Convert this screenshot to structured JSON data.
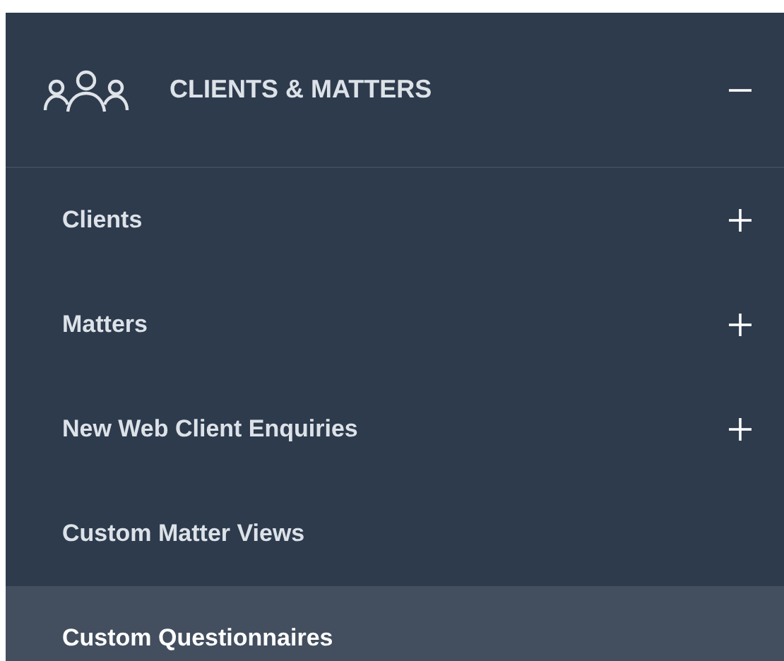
{
  "section": {
    "title": "CLIENTS & MATTERS",
    "expanded": true
  },
  "items": [
    {
      "label": "Clients",
      "kind": "group",
      "expanded": false,
      "selected": false
    },
    {
      "label": "Matters",
      "kind": "group",
      "expanded": false,
      "selected": false
    },
    {
      "label": "New Web Client Enquiries",
      "kind": "group",
      "expanded": false,
      "selected": false
    },
    {
      "label": "Custom Matter Views",
      "kind": "link",
      "selected": false
    },
    {
      "label": "Custom Questionnaires",
      "kind": "link",
      "selected": true
    }
  ]
}
